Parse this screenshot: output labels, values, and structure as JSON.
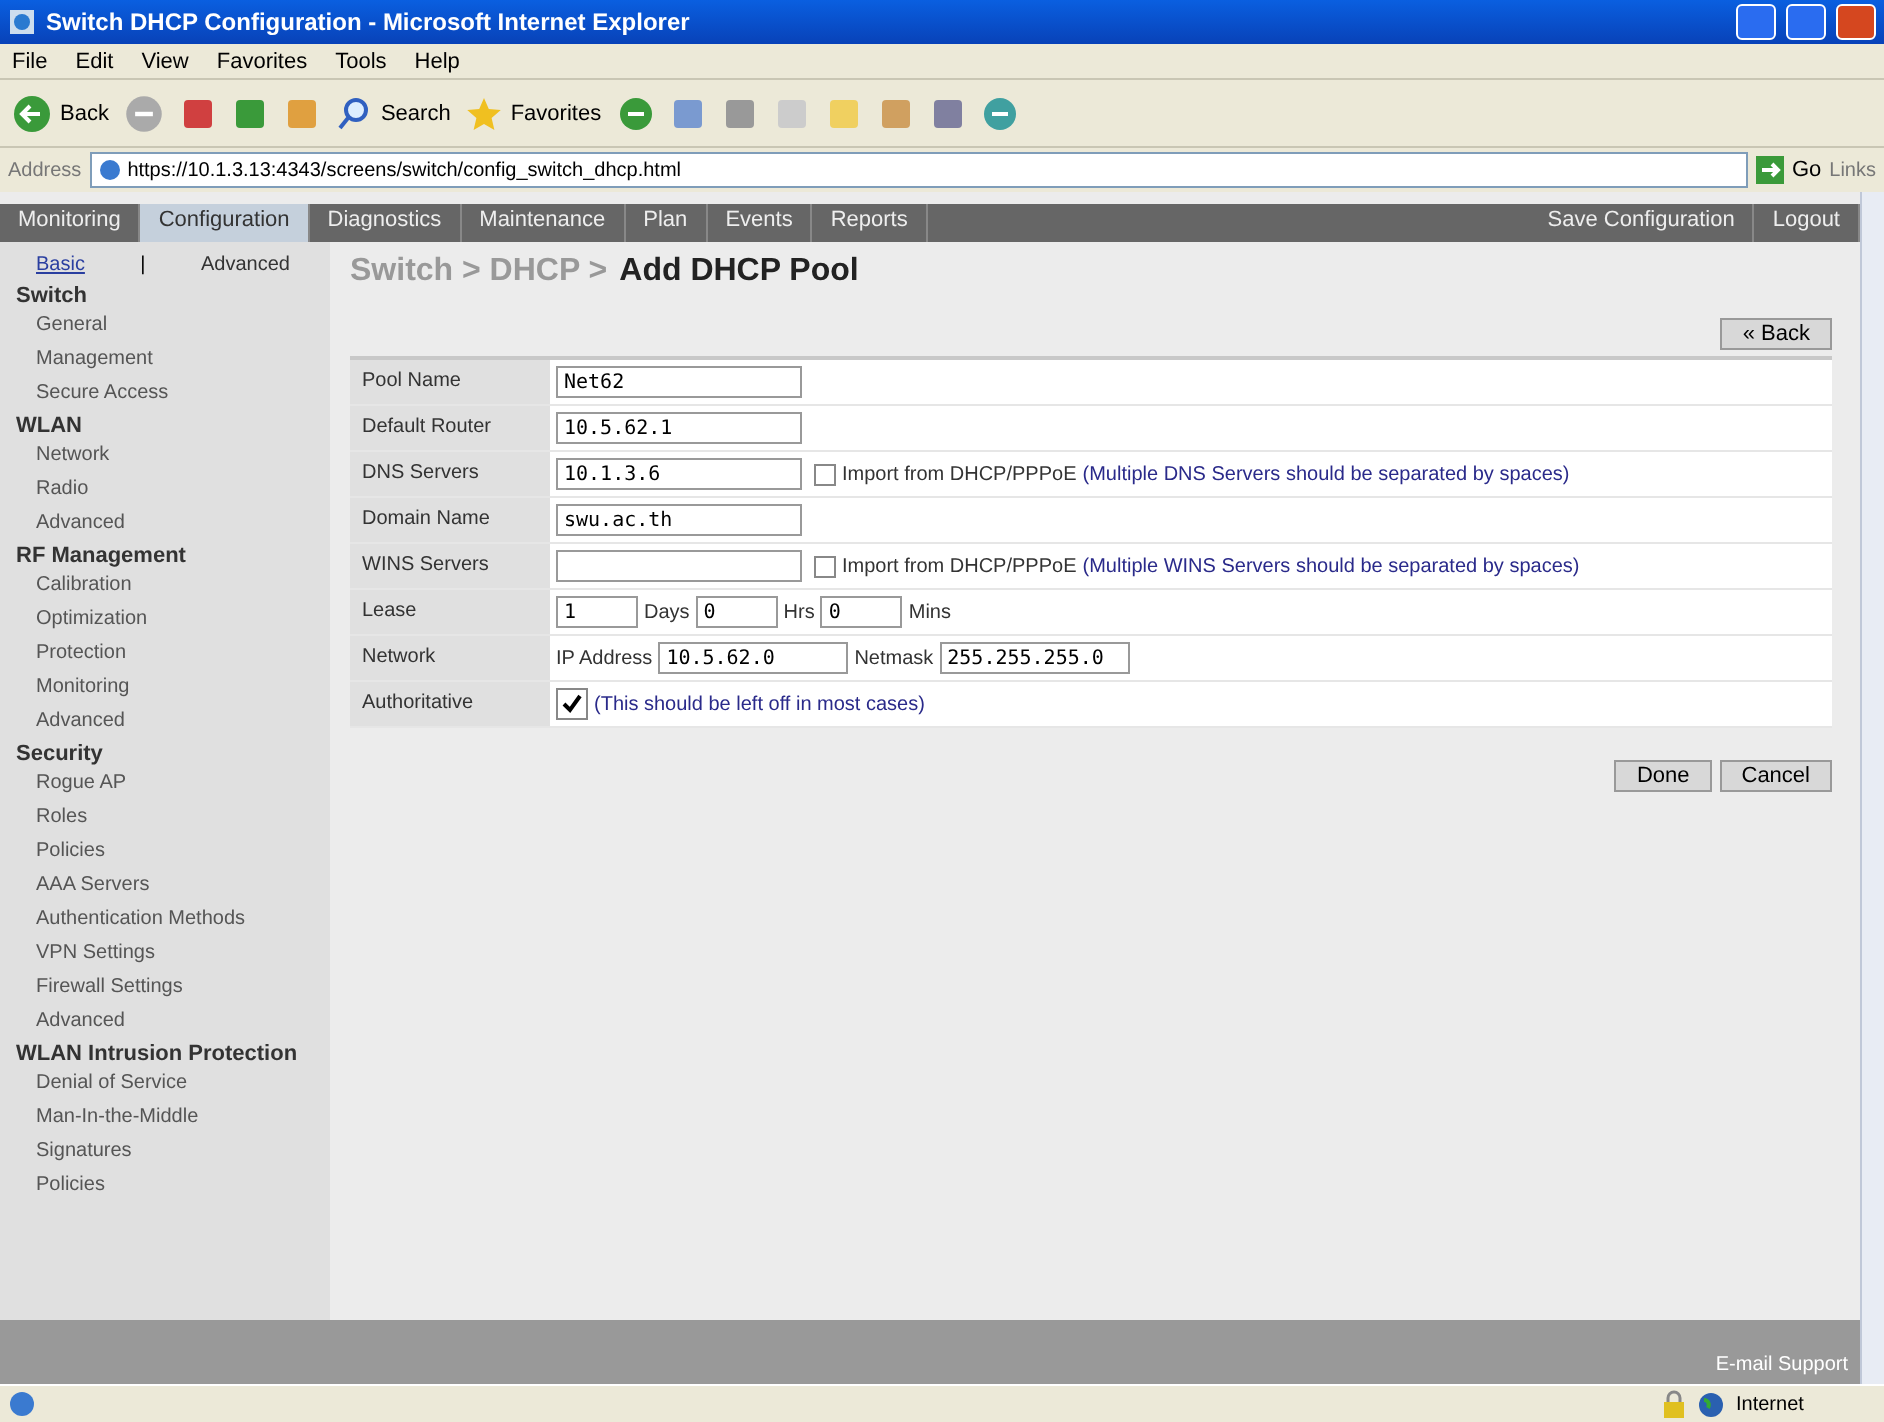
{
  "window": {
    "title": "Switch DHCP Configuration - Microsoft Internet Explorer"
  },
  "menu": [
    "File",
    "Edit",
    "View",
    "Favorites",
    "Tools",
    "Help"
  ],
  "toolbar": {
    "back": "Back",
    "search": "Search",
    "favorites": "Favorites"
  },
  "address": {
    "label": "Address",
    "url": "https://10.1.3.13:4343/screens/switch/config_switch_dhcp.html",
    "go": "Go",
    "links": "Links"
  },
  "nav_tabs": [
    {
      "label": "Monitoring",
      "selected": false
    },
    {
      "label": "Configuration",
      "selected": true
    },
    {
      "label": "Diagnostics",
      "selected": false
    },
    {
      "label": "Maintenance",
      "selected": false
    },
    {
      "label": "Plan",
      "selected": false
    },
    {
      "label": "Events",
      "selected": false
    },
    {
      "label": "Reports",
      "selected": false
    }
  ],
  "nav_actions": [
    "Save Configuration",
    "Logout"
  ],
  "mode": {
    "basic": "Basic",
    "separator": "|",
    "advanced": "Advanced",
    "basic_selected": true
  },
  "sidebar": [
    {
      "label": "Switch",
      "children": [
        "General",
        "Management",
        "Secure Access"
      ]
    },
    {
      "label": "WLAN",
      "children": [
        "Network",
        "Radio",
        "Advanced"
      ]
    },
    {
      "label": "RF Management",
      "children": [
        "Calibration",
        "Optimization",
        "Protection",
        "Monitoring",
        "Advanced"
      ]
    },
    {
      "label": "Security",
      "children": [
        "Rogue AP",
        "Roles",
        "Policies",
        "AAA Servers",
        "Authentication Methods",
        "VPN Settings",
        "Firewall Settings",
        "Advanced"
      ]
    },
    {
      "label": "WLAN Intrusion Protection",
      "children": [
        "Denial of Service",
        "Man-In-the-Middle",
        "Signatures",
        "Policies"
      ]
    }
  ],
  "breadcrumb": {
    "path": "Switch > DHCP >",
    "current": "Add DHCP Pool"
  },
  "back_button": "« Back",
  "form": [
    {
      "kind": "text",
      "label": "Pool Name",
      "value": "Net62"
    },
    {
      "kind": "text",
      "label": "Default Router",
      "value": "10.5.62.1"
    },
    {
      "kind": "import",
      "label": "DNS Servers",
      "value": "10.1.3.6",
      "checked": false,
      "check_label": "Import from DHCP/PPPoE",
      "note": "(Multiple DNS Servers should be separated by spaces)"
    },
    {
      "kind": "text",
      "label": "Domain Name",
      "value": "swu.ac.th"
    },
    {
      "kind": "import",
      "label": "WINS Servers",
      "checked": false,
      "check_label": "Import from DHCP/PPPoE",
      "note": "(Multiple WINS Servers should be separated by spaces)"
    },
    {
      "kind": "lease",
      "label": "Lease",
      "parts": [
        {
          "value": "1",
          "unit": "Days"
        },
        {
          "value": "0",
          "unit": "Hrs"
        },
        {
          "value": "0",
          "unit": "Mins"
        }
      ]
    },
    {
      "kind": "network",
      "label": "Network",
      "parts": [
        {
          "label": "IP Address",
          "value": "10.5.62.0"
        },
        {
          "label": "Netmask",
          "value": "255.255.255.0"
        }
      ]
    },
    {
      "kind": "check",
      "label": "Authoritative",
      "checked": true,
      "note": "(This should be left off in most cases)"
    }
  ],
  "buttons": [
    "Done",
    "Cancel"
  ],
  "footer": {
    "link": "E-mail Support"
  },
  "status_bar": {
    "zone": "Internet"
  }
}
